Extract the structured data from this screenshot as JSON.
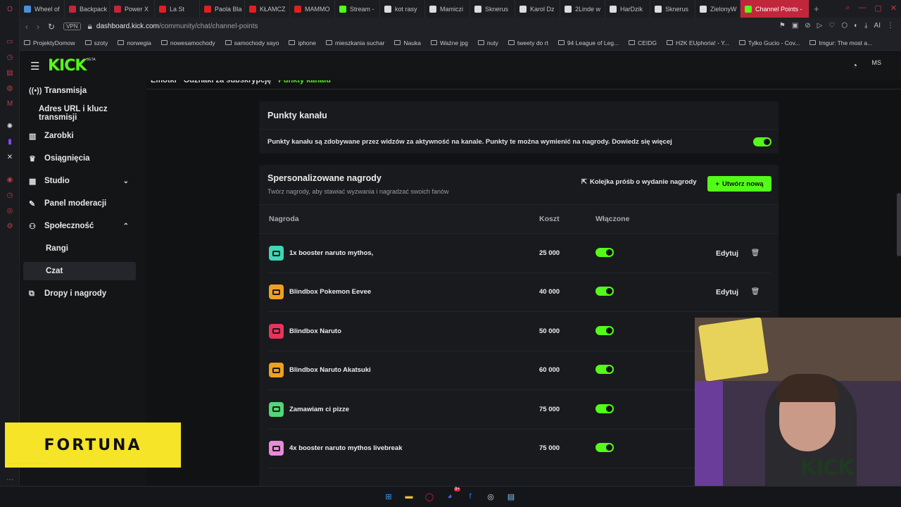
{
  "browser": {
    "tabs": [
      {
        "label": "Wheel of",
        "color": "#4a90d9"
      },
      {
        "label": "Backpack",
        "color": "#c2263b"
      },
      {
        "label": "Power X",
        "color": "#c2263b"
      },
      {
        "label": "La St",
        "color": "#e02020"
      },
      {
        "label": "Paola Bla",
        "color": "#e02020"
      },
      {
        "label": "KŁAMCZ",
        "color": "#e02020"
      },
      {
        "label": "MAMMO",
        "color": "#e02020"
      },
      {
        "label": "Stream -",
        "color": "#53fc18"
      },
      {
        "label": "kot rasy",
        "color": "#dddddd"
      },
      {
        "label": "Mamiczi",
        "color": "#dddddd"
      },
      {
        "label": "Sknerus",
        "color": "#dddddd"
      },
      {
        "label": "Karol Dz",
        "color": "#dddddd"
      },
      {
        "label": "2Linde w",
        "color": "#dddddd"
      },
      {
        "label": "HarDzik",
        "color": "#dddddd"
      },
      {
        "label": "Sknerus",
        "color": "#dddddd"
      },
      {
        "label": "ZielonyW",
        "color": "#dddddd"
      },
      {
        "label": "Channel Points -",
        "color": "#53fc18"
      }
    ],
    "vpn": "VPN",
    "url_domain": "dashboard.kick.com",
    "url_path": "/community/chat/channel-points",
    "addr_ai": "AI",
    "bookmarks": [
      "ProjektyDomow",
      "szoty",
      "norwegia",
      "nowesamochody",
      "samochody xayo",
      "iphone",
      "mieszkania suchar",
      "Nauka",
      "Ważne jpg",
      "nuty",
      "tweety do rt",
      "94 League of Leg...",
      "CEIDG",
      "H2K EUphoria! - Y...",
      "Tylko Gucio - Cov...",
      "Imgur: The most a..."
    ]
  },
  "kick": {
    "logo": "KICK",
    "logo_badge": "BETA",
    "avatar": "MS"
  },
  "sidebar": {
    "items": [
      {
        "label": "Transmisja",
        "icon": "broadcast-icon"
      },
      {
        "label": "Adres URL i klucz transmisji"
      },
      {
        "label": "Zarobki",
        "icon": "chart-icon"
      },
      {
        "label": "Osiągnięcia",
        "icon": "trophy-icon"
      },
      {
        "label": "Studio",
        "icon": "studio-icon"
      },
      {
        "label": "Panel moderacji",
        "icon": "wrench-icon"
      },
      {
        "label": "Społeczność",
        "icon": "people-icon"
      },
      {
        "label": "Rangi"
      },
      {
        "label": "Czat"
      },
      {
        "label": "Dropy i nagrody",
        "icon": "gift-icon"
      }
    ]
  },
  "subtabs": [
    "Emotki",
    "Odznaki za subskrypcję",
    "Punkty kanału"
  ],
  "points_card": {
    "title": "Punkty kanału",
    "description": "Punkty kanału są zdobywane przez widzów za aktywność na kanale. Punkty te można wymienić na nagrody. Dowiedz się więcej",
    "enabled": true
  },
  "rewards": {
    "title": "Spersonalizowane nagrody",
    "subtitle": "Twórz nagrody, aby stawiać wyzwania i nagradzać swoich fanów",
    "queue_label": "Kolejka próśb o wydanie nagrody",
    "create_label": "Utwórz nową",
    "columns": {
      "reward": "Nagroda",
      "cost": "Koszt",
      "enabled": "Włączone"
    },
    "edit_label": "Edytuj",
    "items": [
      {
        "name": "1x booster naruto mythos,",
        "cost": "25 000",
        "color": "#3fd6b6",
        "enabled": true
      },
      {
        "name": "Blindbox Pokemon Eevee",
        "cost": "40 000",
        "color": "#f0a020",
        "enabled": true
      },
      {
        "name": "Blindbox Naruto",
        "cost": "50 000",
        "color": "#e8345a",
        "enabled": true
      },
      {
        "name": "Blindbox Naruto Akatsuki",
        "cost": "60 000",
        "color": "#f0a020",
        "enabled": true
      },
      {
        "name": "Zamawiam ci pizze",
        "cost": "75 000",
        "color": "#53d676",
        "enabled": true
      },
      {
        "name": "4x booster naruto mythos livebreak",
        "cost": "75 000",
        "color": "#e98ad8",
        "enabled": true
      }
    ]
  },
  "overlay": {
    "fortuna": "FORTUNA",
    "cam_logo": "KICK"
  },
  "taskbar": {
    "notification_count": "9+"
  }
}
